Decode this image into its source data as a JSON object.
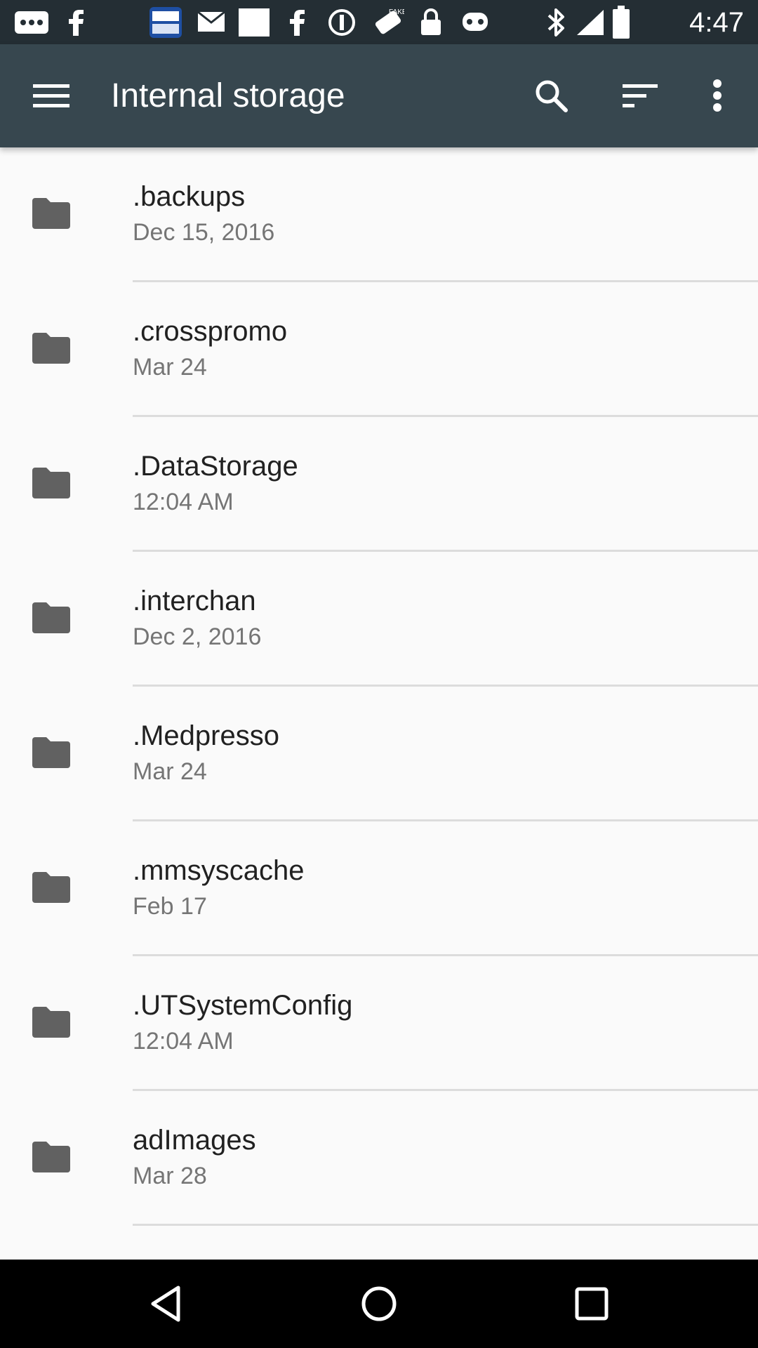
{
  "status_bar": {
    "time": "4:47",
    "icons": [
      "more-notifications-icon",
      "facebook-icon",
      "kbs-news-icon",
      "email-icon",
      "blank-notification-icon",
      "facebook-icon",
      "dnd-icon",
      "fake-gps-icon",
      "lock-icon",
      "game-controller-icon",
      "bluetooth-icon",
      "signal-icon",
      "battery-icon"
    ]
  },
  "app_bar": {
    "title": "Internal storage",
    "icons": [
      "menu-icon",
      "search-icon",
      "sort-icon",
      "more-vert-icon"
    ]
  },
  "files": [
    {
      "name": ".backups",
      "date": "Dec 15, 2016"
    },
    {
      "name": ".crosspromo",
      "date": "Mar 24"
    },
    {
      "name": ".DataStorage",
      "date": "12:04 AM"
    },
    {
      "name": ".interchan",
      "date": "Dec 2, 2016"
    },
    {
      "name": ".Medpresso",
      "date": "Mar 24"
    },
    {
      "name": ".mmsyscache",
      "date": "Feb 17"
    },
    {
      "name": ".UTSystemConfig",
      "date": "12:04 AM"
    },
    {
      "name": "adImages",
      "date": "Mar 28"
    }
  ],
  "nav_bar": {
    "icons": [
      "back-icon",
      "home-icon",
      "recents-icon"
    ]
  },
  "colors": {
    "status_bar": "#242e34",
    "app_bar": "#37474f",
    "background": "#fafafa",
    "folder_icon": "#616161"
  }
}
